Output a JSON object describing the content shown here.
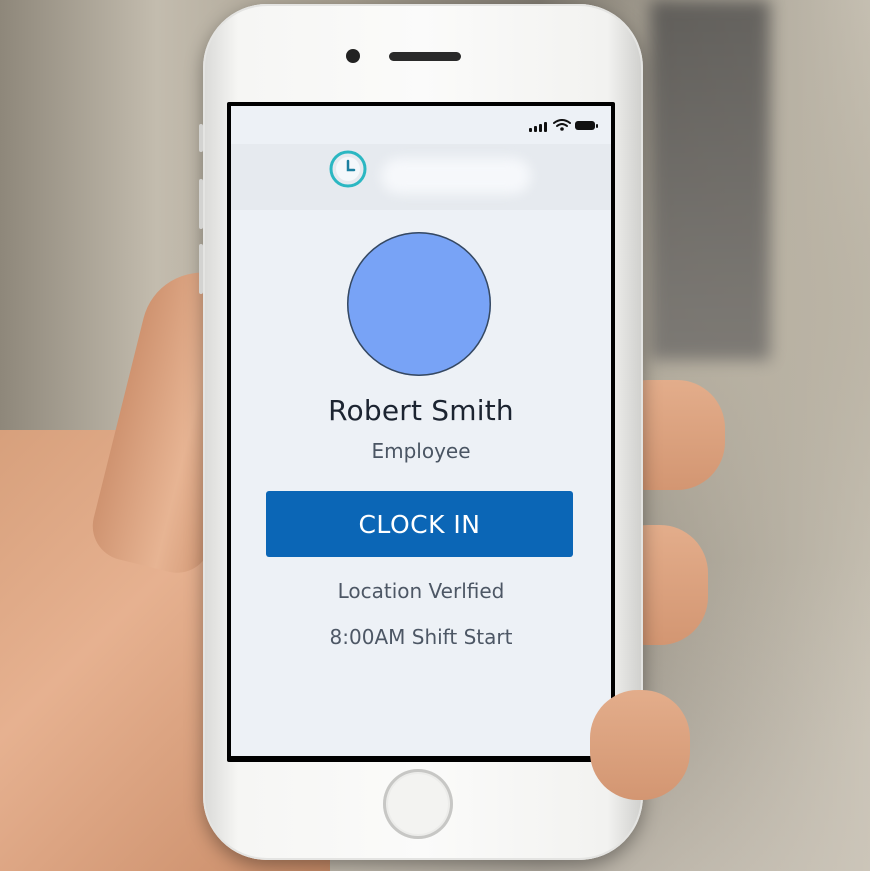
{
  "app": {
    "logo_icon": "clock-icon",
    "accent_color": "#2bb7c2"
  },
  "status_bar": {
    "signal_icon": "cellular-signal-icon",
    "wifi_icon": "wifi-icon",
    "battery_icon": "battery-icon"
  },
  "profile": {
    "avatar_color": "#78a3f6",
    "name": "Robert Smith",
    "role": "Employee"
  },
  "actions": {
    "clock_in_label": "CLOCK IN",
    "button_color": "#0b66b6"
  },
  "info": {
    "location_status": "Location Verlfied",
    "shift": "8:00AM Shift Start"
  }
}
